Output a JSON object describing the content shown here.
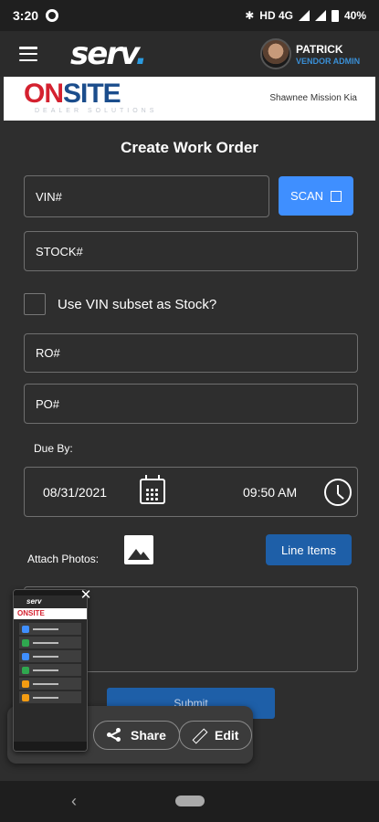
{
  "status_bar": {
    "time": "3:20",
    "network": "HD 4G",
    "battery": "40%"
  },
  "app_bar": {
    "logo_text": "serv",
    "logo_dot": ".",
    "user_name": "PATRICK",
    "user_role": "VENDOR ADMIN"
  },
  "dealer": {
    "logo_on": "ON",
    "logo_site": "SITE",
    "logo_sub": "DEALER SOLUTIONS",
    "name": "Shawnee Mission Kia"
  },
  "form": {
    "title": "Create Work Order",
    "vin_placeholder": "VIN#",
    "scan_label": "SCAN",
    "stock_placeholder": "STOCK#",
    "vin_subset_label": "Use VIN subset as Stock?",
    "ro_placeholder": "RO#",
    "po_placeholder": "PO#",
    "due_by_label": "Due By:",
    "due_date": "08/31/2021",
    "due_time": "09:50 AM",
    "attach_label": "Attach Photos:",
    "line_items_label": "Line Items",
    "submit_label": "Submit"
  },
  "share_overlay": {
    "share_label": "Share",
    "edit_label": "Edit",
    "thumbnail": {
      "app_text": "serv",
      "banner_text": "ONSITE",
      "menu_colors": [
        "#3f8fff",
        "#2fa84f",
        "#3f8fff",
        "#2fa84f",
        "#f39c12",
        "#f39c12"
      ]
    }
  },
  "colors": {
    "accent_blue": "#3f8fff",
    "line_items_blue": "#1e5fa8",
    "background": "#2e2e2e",
    "onsite_red": "#d4212f",
    "onsite_navy": "#1b4d8c"
  }
}
